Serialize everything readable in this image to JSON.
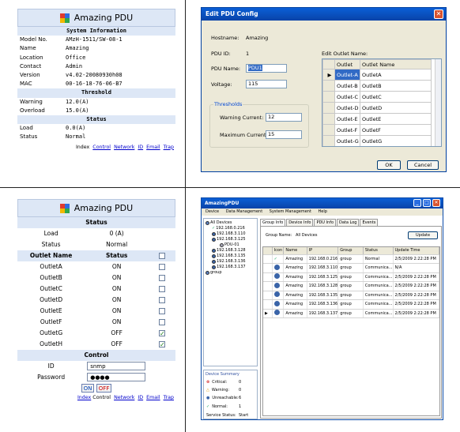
{
  "web_top": {
    "title": "Amazing PDU",
    "sections": {
      "system": "System Information",
      "threshold": "Threshold",
      "status": "Status"
    },
    "system_info": [
      {
        "key": "Model No.",
        "value": "AMzH-1511/SW-08-1"
      },
      {
        "key": "Name",
        "value": "Amazing"
      },
      {
        "key": "Location",
        "value": "Office"
      },
      {
        "key": "Contact",
        "value": "Admin"
      },
      {
        "key": "Version",
        "value": "v4.02-20080930h08"
      },
      {
        "key": "MAC",
        "value": "00-16-18-76-06-B7"
      }
    ],
    "threshold": [
      {
        "key": "Warning",
        "value": "12.0(A)"
      },
      {
        "key": "Overload",
        "value": "15.0(A)"
      }
    ],
    "status": [
      {
        "key": "Load",
        "value": "0.0(A)"
      },
      {
        "key": "Status",
        "value": "Normal"
      }
    ],
    "links_label": "Index",
    "links": [
      "Control",
      "Network",
      "ID",
      "Email",
      "Trap"
    ]
  },
  "web_bottom": {
    "title": "Amazing PDU",
    "status_header": "Status",
    "load_label": "Load",
    "load_value": "0 (A)",
    "status_label": "Status",
    "status_value": "Normal",
    "outlet_header": "Outlet Name",
    "outlet_status_header": "Status",
    "outlets": [
      {
        "name": "OutletA",
        "status": "ON",
        "checked": false
      },
      {
        "name": "OutletB",
        "status": "ON",
        "checked": false
      },
      {
        "name": "OutletC",
        "status": "ON",
        "checked": false
      },
      {
        "name": "OutletD",
        "status": "ON",
        "checked": false
      },
      {
        "name": "OutletE",
        "status": "ON",
        "checked": false
      },
      {
        "name": "OutletF",
        "status": "ON",
        "checked": false
      },
      {
        "name": "OutletG",
        "status": "OFF",
        "checked": true
      },
      {
        "name": "OutletH",
        "status": "OFF",
        "checked": true
      }
    ],
    "control_header": "Control",
    "id_label": "ID",
    "id_value": "snmp",
    "password_label": "Password",
    "password_value": "●●●●",
    "on_label": "ON",
    "off_label": "OFF",
    "links": [
      "Index",
      "Control",
      "Network",
      "ID",
      "Email",
      "Trap"
    ]
  },
  "dialog": {
    "title": "Edit PDU Config",
    "close_glyph": "✕",
    "hostname_label": "Hostname:",
    "hostname_value": "Amazing",
    "pdu_id_label": "PDU ID:",
    "pdu_id_value": "1",
    "pdu_name_label": "PDU Name:",
    "pdu_name_value": "PDU1",
    "voltage_label": "Voltage:",
    "voltage_value": "115",
    "thresholds_label": "Thresholds",
    "warning_label": "Warning Current:",
    "warning_value": "12",
    "maximum_label": "Maximum Current:",
    "maximum_value": "15",
    "edit_outlet_label": "Edit Outlet Name:",
    "outlet_col": "Outlet",
    "name_col": "Outlet Name",
    "outlets": [
      {
        "outlet": "Outlet-A",
        "name": "OutletA"
      },
      {
        "outlet": "Outlet-B",
        "name": "OutletB"
      },
      {
        "outlet": "Outlet-C",
        "name": "OutletC"
      },
      {
        "outlet": "Outlet-D",
        "name": "OutletD"
      },
      {
        "outlet": "Outlet-E",
        "name": "OutletE"
      },
      {
        "outlet": "Outlet-F",
        "name": "OutletF"
      },
      {
        "outlet": "Outlet-G",
        "name": "OutletG"
      }
    ],
    "ok_label": "OK",
    "cancel_label": "Cancel"
  },
  "app": {
    "title": "AmazingPDU",
    "menu": [
      "Device",
      "Data Management",
      "System Management",
      "Help"
    ],
    "tree": {
      "root": "All Devices",
      "devices": [
        "192.168.0.216",
        "192.168.3.110",
        "192.168.3.125",
        "PDU-01",
        "192.168.3.128",
        "192.168.3.135",
        "192.168.3.136",
        "192.168.3.137"
      ],
      "group": "group"
    },
    "summary": {
      "title": "Device Summary",
      "rows": [
        {
          "label": "Critical:",
          "count": "0"
        },
        {
          "label": "Warning:",
          "count": "0"
        },
        {
          "label": "Unreachable:",
          "count": "6"
        },
        {
          "label": "Normal:",
          "count": "1"
        }
      ],
      "service_label": "Service Status:",
      "service_value": "Start"
    },
    "tabs": [
      "Group Info",
      "Device Info",
      "PDU Info",
      "Data Log",
      "Events"
    ],
    "group_name_label": "Group Name:",
    "group_name_value": "All Devices",
    "update_label": "Update",
    "columns": [
      "Icon",
      "Name",
      "IP",
      "Group",
      "Status",
      "Update Time"
    ],
    "rows": [
      {
        "name": "Amazing",
        "ip": "192.168.0.216",
        "group": "group",
        "status": "Normal",
        "time": "2/5/2009 2:22:28 PM"
      },
      {
        "name": "Amazing",
        "ip": "192.168.3.110",
        "group": "group",
        "status": "Communica...",
        "time": "N/A"
      },
      {
        "name": "Amazing",
        "ip": "192.168.3.125",
        "group": "group",
        "status": "Communica...",
        "time": "2/5/2009 2:22:28 PM"
      },
      {
        "name": "Amazing",
        "ip": "192.168.3.128",
        "group": "group",
        "status": "Communica...",
        "time": "2/5/2009 2:22:28 PM"
      },
      {
        "name": "Amazing",
        "ip": "192.168.3.135",
        "group": "group",
        "status": "Communica...",
        "time": "2/5/2009 2:22:28 PM"
      },
      {
        "name": "Amazing",
        "ip": "192.168.3.136",
        "group": "group",
        "status": "Communica...",
        "time": "2/5/2009 2:22:28 PM"
      },
      {
        "name": "Amazing",
        "ip": "192.168.3.137",
        "group": "group",
        "status": "Communica...",
        "time": "2/5/2009 2:22:28 PM"
      }
    ]
  }
}
